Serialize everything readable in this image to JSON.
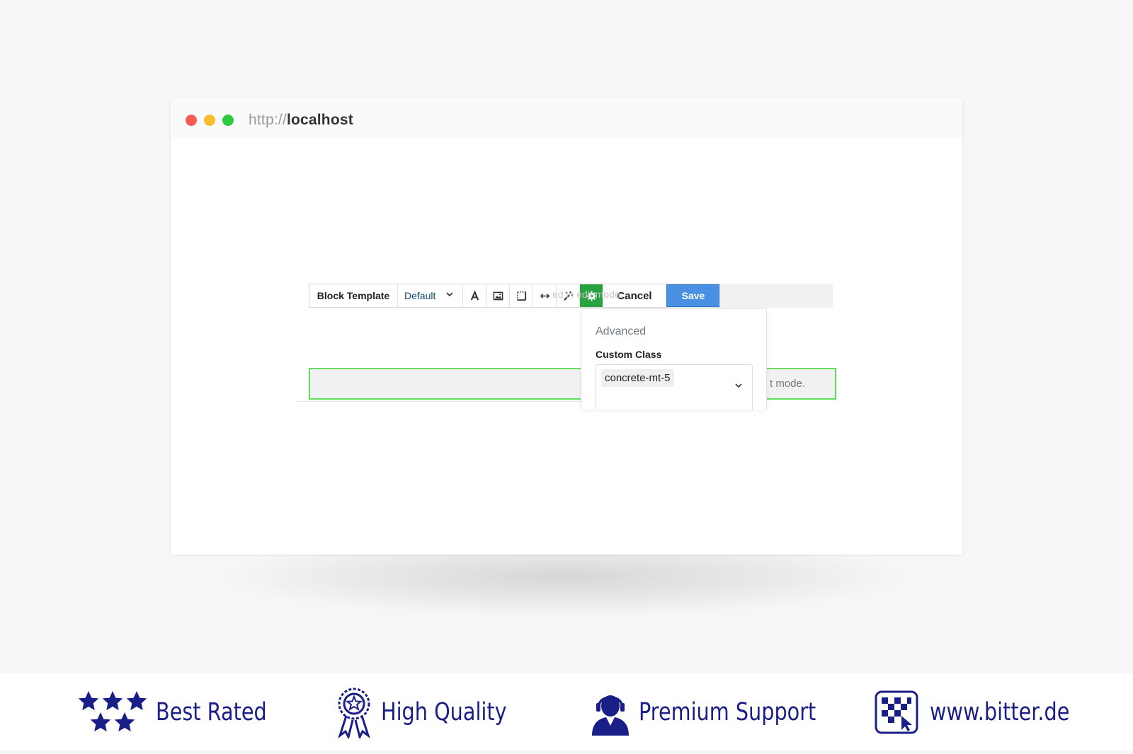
{
  "browser": {
    "url_protocol": "http://",
    "url_host": "localhost",
    "traffic_lights": [
      "#f35b57",
      "#f6bd2e",
      "#2dca42"
    ]
  },
  "toolbar": {
    "block_template_label": "Block Template",
    "template_value": "Default",
    "icons": [
      "font-icon",
      "image-icon",
      "border-icon",
      "resize-icon",
      "magic-wand-icon",
      "gear-icon"
    ],
    "cancel_label": "Cancel",
    "save_label": "Save",
    "ghost_text": "ed in edit mode."
  },
  "block": {
    "text": "t mode."
  },
  "advanced_panel": {
    "title": "Advanced",
    "custom_class_label": "Custom Class",
    "custom_class_value": "concrete-mt-5"
  },
  "footer": {
    "features": [
      {
        "label": "Best Rated",
        "icon": "stars-icon"
      },
      {
        "label": "High Quality",
        "icon": "award-icon"
      },
      {
        "label": "Premium Support",
        "icon": "support-agent-icon"
      },
      {
        "label": "www.bitter.de",
        "icon": "bitter-logo-icon"
      }
    ]
  },
  "colors": {
    "accent_blue": "#4a90e2",
    "accent_green": "#27a23c",
    "block_border": "#5fdc5c",
    "brand_navy": "#1a1f87"
  }
}
